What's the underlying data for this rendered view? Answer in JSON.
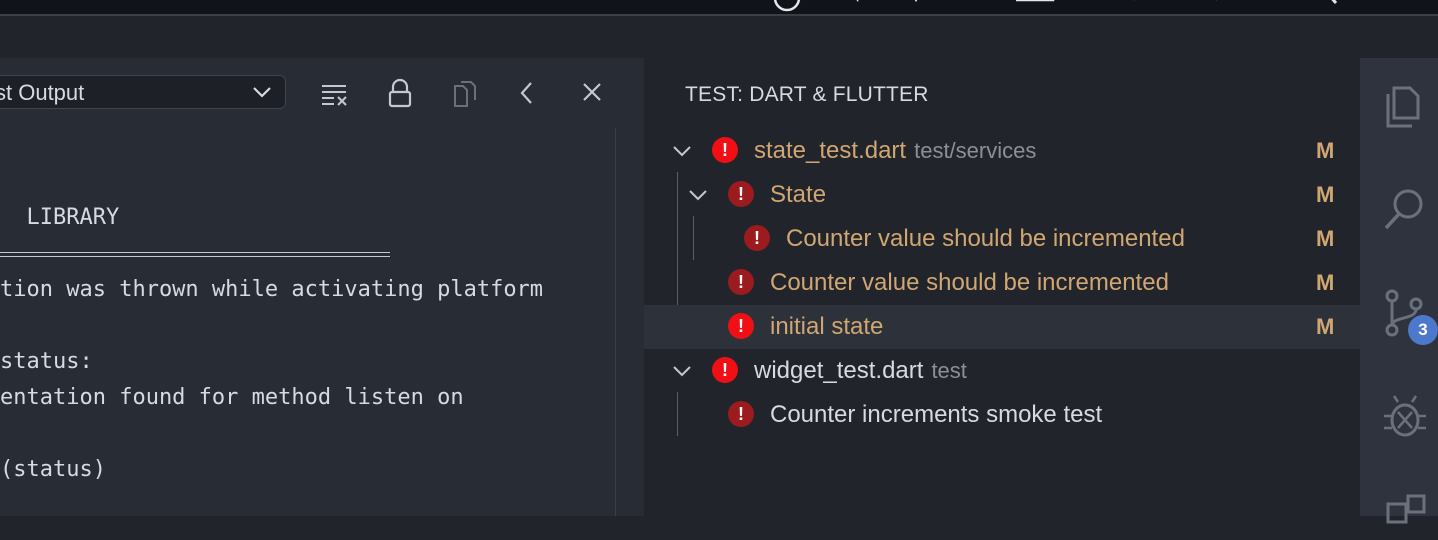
{
  "output": {
    "dropdown_value": "st Output",
    "lines": [
      "  LIBRARY",
      "tion was thrown while activating platform",
      "",
      "status:",
      "entation found for method listen on",
      "",
      "(status)"
    ]
  },
  "tests": {
    "title": "TEST: DART & FLUTTER",
    "rows": [
      {
        "label": "state_test.dart",
        "path": "test/services",
        "status": "M"
      },
      {
        "label": "State",
        "path": "",
        "status": "M"
      },
      {
        "label": "Counter value should be incremented",
        "path": "",
        "status": "M"
      },
      {
        "label": "Counter value should be incremented",
        "path": "",
        "status": "M"
      },
      {
        "label": "initial state",
        "path": "",
        "status": "M"
      },
      {
        "label": "widget_test.dart",
        "path": "test",
        "status": ""
      },
      {
        "label": "Counter increments smoke test",
        "path": "",
        "status": ""
      }
    ]
  },
  "activity": {
    "scm_badge": "3",
    "icons": [
      "explorer-icon",
      "search-icon",
      "source-control-icon",
      "debug-icon",
      "extensions-icon"
    ]
  },
  "colors": {
    "error_bright": "#f00f14",
    "error_dark": "#9b1b1f",
    "modified": "#d0a672",
    "badge": "#4d78cc"
  }
}
